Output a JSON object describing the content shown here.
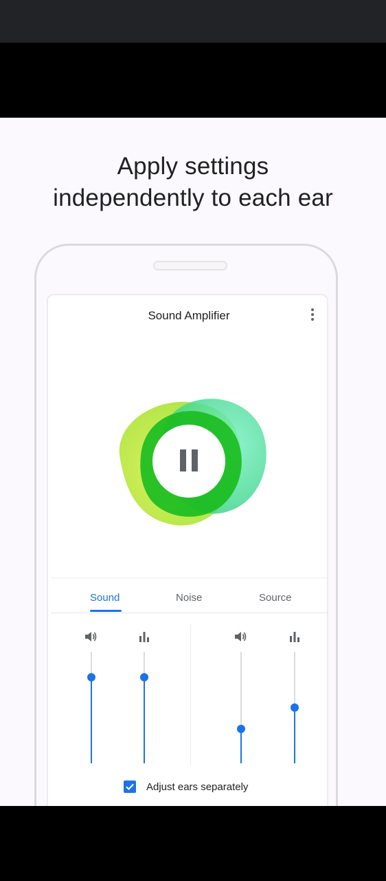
{
  "headline": {
    "line1": "Apply settings",
    "line2": "independently to each ear"
  },
  "app": {
    "title": "Sound Amplifier",
    "menu_icon": "more-vert-icon",
    "play_state_icon": "pause-icon"
  },
  "tabs": [
    {
      "label": "Sound",
      "active": true
    },
    {
      "label": "Noise",
      "active": false
    },
    {
      "label": "Source",
      "active": false
    }
  ],
  "sliders": [
    {
      "ear": "left",
      "type": "volume",
      "icon": "volume-icon",
      "level": 0.77
    },
    {
      "ear": "left",
      "type": "fine-tuning",
      "icon": "bar-chart-icon",
      "level": 0.77
    },
    {
      "ear": "right",
      "type": "volume",
      "icon": "volume-icon",
      "level": 0.31
    },
    {
      "ear": "right",
      "type": "fine-tuning",
      "icon": "bar-chart-icon",
      "level": 0.5
    }
  ],
  "adjust_ears": {
    "label": "Adjust ears separately",
    "checked": true
  },
  "colors": {
    "accent": "#1a73e8",
    "blob_green": "#18b51e",
    "blob_lime": "#b8e64a",
    "blob_teal": "#5ee3a3"
  }
}
